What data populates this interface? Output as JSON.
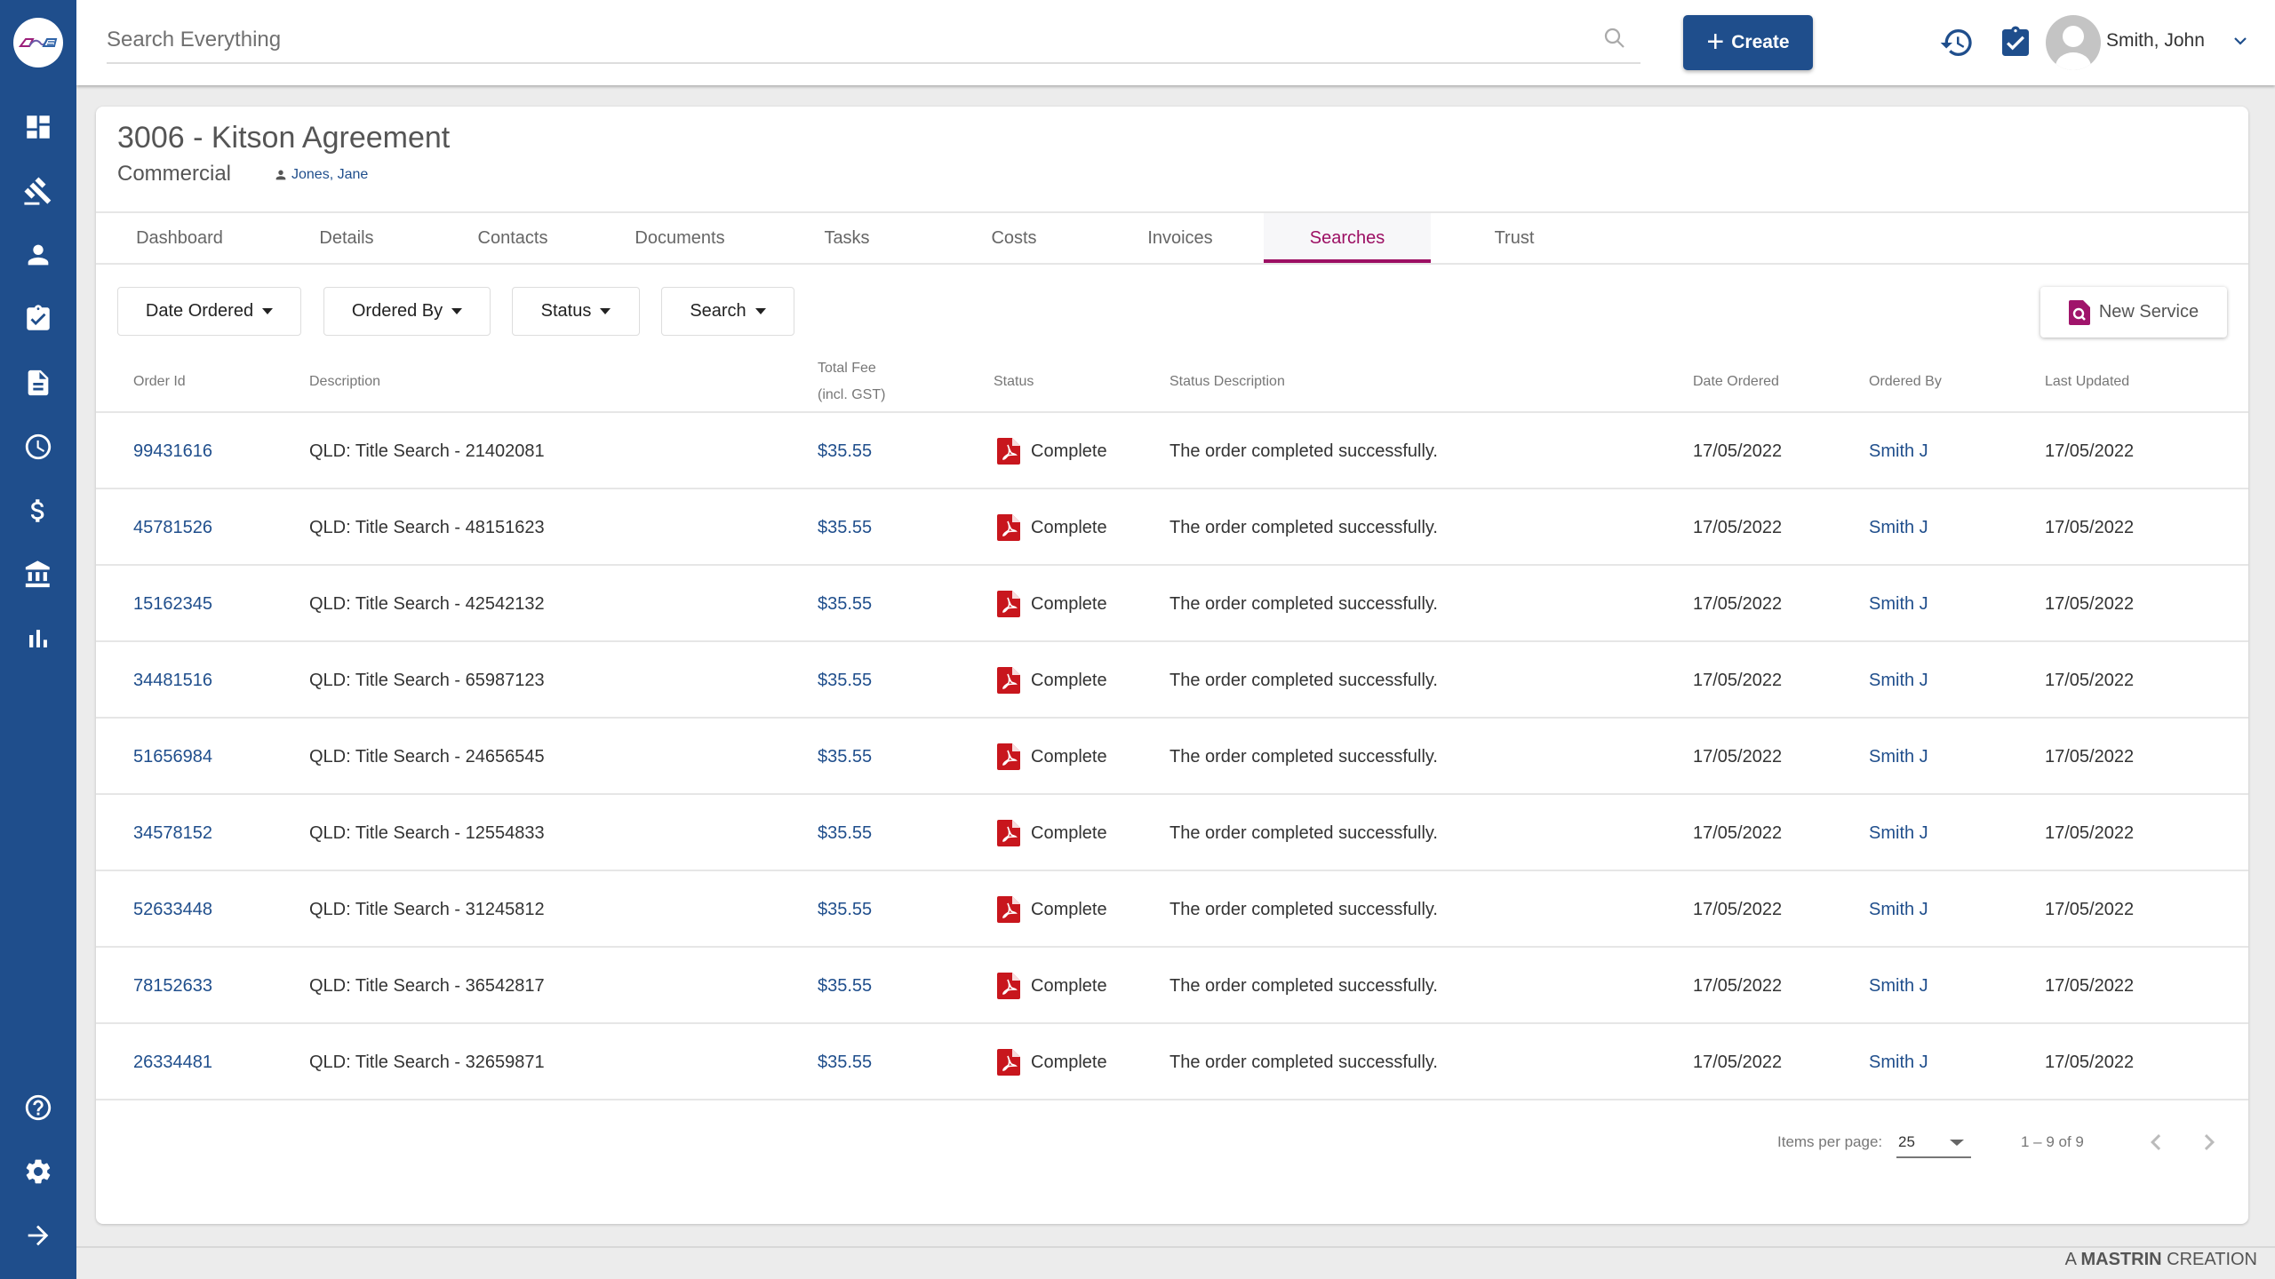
{
  "sidebar": {
    "logo": "app-logo",
    "top_items": [
      {
        "name": "dashboard",
        "icon": "dashboard-icon"
      },
      {
        "name": "matters",
        "icon": "gavel-icon"
      },
      {
        "name": "contacts",
        "icon": "person-icon"
      },
      {
        "name": "tasks",
        "icon": "clipboard-check-icon"
      },
      {
        "name": "documents",
        "icon": "document-icon"
      },
      {
        "name": "time",
        "icon": "clock-icon"
      },
      {
        "name": "billing",
        "icon": "dollar-icon"
      },
      {
        "name": "trust",
        "icon": "bank-icon"
      },
      {
        "name": "reports",
        "icon": "bar-chart-icon"
      }
    ],
    "bottom_items": [
      {
        "name": "help",
        "icon": "help-icon"
      },
      {
        "name": "settings",
        "icon": "gear-icon"
      },
      {
        "name": "expand",
        "icon": "arrow-right-icon"
      }
    ]
  },
  "header": {
    "search_placeholder": "Search Everything",
    "create_label": "Create",
    "icons": [
      "history-icon",
      "task-check-icon",
      "briefcase-timer-icon"
    ],
    "user_name": "Smith, John"
  },
  "matter": {
    "title": "3006 - Kitson Agreement",
    "type": "Commercial",
    "owner": "Jones, Jane"
  },
  "tabs": [
    {
      "label": "Dashboard",
      "active": false
    },
    {
      "label": "Details",
      "active": false
    },
    {
      "label": "Contacts",
      "active": false
    },
    {
      "label": "Documents",
      "active": false
    },
    {
      "label": "Tasks",
      "active": false
    },
    {
      "label": "Costs",
      "active": false
    },
    {
      "label": "Invoices",
      "active": false
    },
    {
      "label": "Searches",
      "active": true
    },
    {
      "label": "Trust",
      "active": false
    }
  ],
  "filters": [
    {
      "label": "Date Ordered"
    },
    {
      "label": "Ordered By"
    },
    {
      "label": "Status"
    },
    {
      "label": "Search"
    }
  ],
  "new_service_label": "New Service",
  "table": {
    "columns": {
      "order_id": "Order Id",
      "description": "Description",
      "total_fee_1": "Total Fee",
      "total_fee_2": "(incl. GST)",
      "status": "Status",
      "status_description": "Status Description",
      "date_ordered": "Date Ordered",
      "ordered_by": "Ordered By",
      "last_updated": "Last Updated"
    },
    "rows": [
      {
        "order_id": "99431616",
        "description": "QLD: Title Search - 21402081",
        "fee": "$35.55",
        "status": "Complete",
        "status_description": "The order completed successfully.",
        "date_ordered": "17/05/2022",
        "ordered_by": "Smith J",
        "last_updated": "17/05/2022"
      },
      {
        "order_id": "45781526",
        "description": "QLD: Title Search - 48151623",
        "fee": "$35.55",
        "status": "Complete",
        "status_description": "The order completed successfully.",
        "date_ordered": "17/05/2022",
        "ordered_by": "Smith J",
        "last_updated": "17/05/2022"
      },
      {
        "order_id": "15162345",
        "description": "QLD: Title Search - 42542132",
        "fee": "$35.55",
        "status": "Complete",
        "status_description": "The order completed successfully.",
        "date_ordered": "17/05/2022",
        "ordered_by": "Smith J",
        "last_updated": "17/05/2022"
      },
      {
        "order_id": "34481516",
        "description": "QLD: Title Search - 65987123",
        "fee": "$35.55",
        "status": "Complete",
        "status_description": "The order completed successfully.",
        "date_ordered": "17/05/2022",
        "ordered_by": "Smith J",
        "last_updated": "17/05/2022"
      },
      {
        "order_id": "51656984",
        "description": "QLD: Title Search - 24656545",
        "fee": "$35.55",
        "status": "Complete",
        "status_description": "The order completed successfully.",
        "date_ordered": "17/05/2022",
        "ordered_by": "Smith J",
        "last_updated": "17/05/2022"
      },
      {
        "order_id": "34578152",
        "description": "QLD: Title Search - 12554833",
        "fee": "$35.55",
        "status": "Complete",
        "status_description": "The order completed successfully.",
        "date_ordered": "17/05/2022",
        "ordered_by": "Smith J",
        "last_updated": "17/05/2022"
      },
      {
        "order_id": "52633448",
        "description": "QLD: Title Search - 31245812",
        "fee": "$35.55",
        "status": "Complete",
        "status_description": "The order completed successfully.",
        "date_ordered": "17/05/2022",
        "ordered_by": "Smith J",
        "last_updated": "17/05/2022"
      },
      {
        "order_id": "78152633",
        "description": "QLD: Title Search - 36542817",
        "fee": "$35.55",
        "status": "Complete",
        "status_description": "The order completed successfully.",
        "date_ordered": "17/05/2022",
        "ordered_by": "Smith J",
        "last_updated": "17/05/2022"
      },
      {
        "order_id": "26334481",
        "description": "QLD: Title Search - 32659871",
        "fee": "$35.55",
        "status": "Complete",
        "status_description": "The order completed successfully.",
        "date_ordered": "17/05/2022",
        "ordered_by": "Smith J",
        "last_updated": "17/05/2022"
      }
    ]
  },
  "pagination": {
    "items_per_page_label": "Items per page:",
    "items_per_page": "25",
    "range": "1 – 9 of 9"
  },
  "footer": {
    "prefix": "A",
    "brand": "MASTRIN",
    "suffix": "CREATION"
  },
  "colors": {
    "brand_blue": "#1f4e8c",
    "active_tab": "#9c0f63",
    "pdf_red": "#c8161d"
  }
}
